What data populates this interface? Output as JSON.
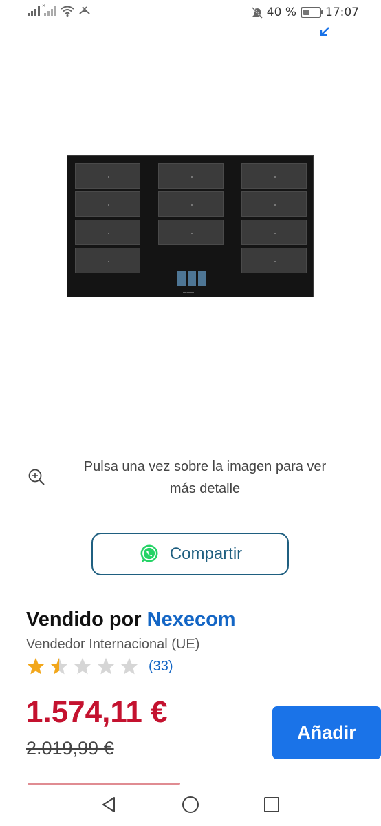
{
  "status_bar": {
    "battery_percent": "40 %",
    "battery_level": 0.4,
    "time": "17:07",
    "icons": [
      "signal-icon",
      "signal-no-sim-icon",
      "wifi-icon",
      "call-forward-icon",
      "mute-bell-icon",
      "battery-icon"
    ]
  },
  "product": {
    "image_alt": "cooktop-image",
    "zoom_hint_line1": "Pulsa una vez sobre la imagen para ver",
    "zoom_hint_line2": "más detalle",
    "share_label": "Compartir"
  },
  "seller": {
    "prefix": "Vendido por ",
    "name": "Nexecom",
    "type": "Vendedor Internacional (UE)",
    "rating_stars": 1.5,
    "rating_max": 5,
    "review_count": "(33)"
  },
  "pricing": {
    "price": "1.574,11 €",
    "old_price": "2.019,99 €",
    "add_label": "Añadir"
  },
  "colors": {
    "accent": "#1a73e8",
    "price": "#c4122f",
    "star_filled": "#f2a71b",
    "star_empty": "#d6d6d6",
    "whatsapp": "#25d366"
  }
}
